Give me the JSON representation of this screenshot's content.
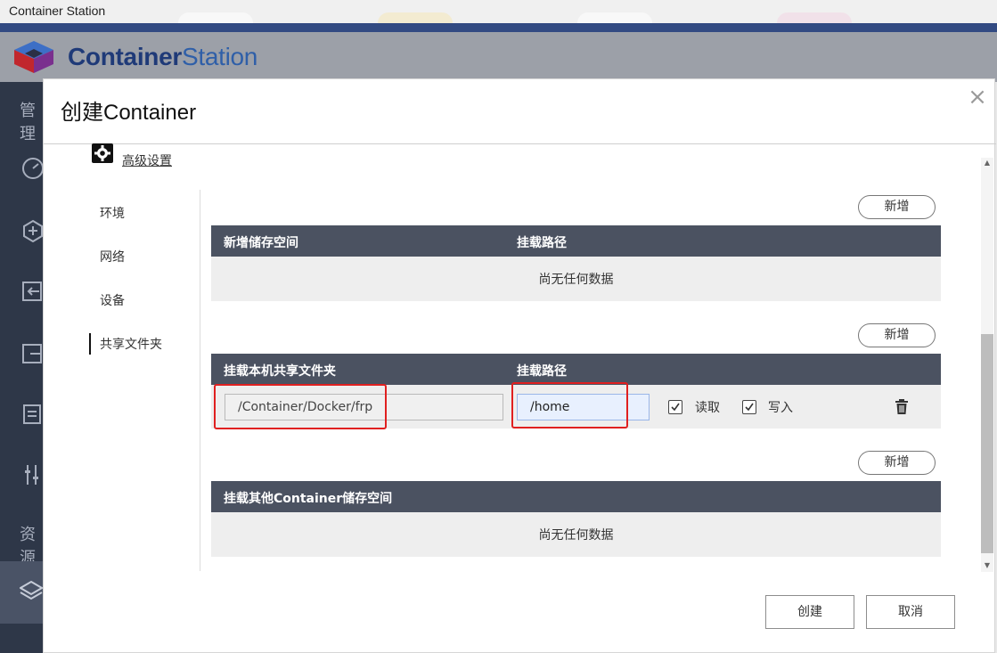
{
  "window": {
    "title": "Container Station"
  },
  "app": {
    "name_bold": "Container",
    "name_light": "Station"
  },
  "sidebar": {
    "group1": "管理",
    "group2": "资源"
  },
  "modal": {
    "title": "创建Container",
    "advanced_link": "高级设置",
    "nav": [
      "环境",
      "网络",
      "设备",
      "共享文件夹"
    ],
    "active_nav": "共享文件夹",
    "add_label": "新增",
    "section1": {
      "col1": "新增储存空间",
      "col2": "挂载路径",
      "empty": "尚无任何数据"
    },
    "section2": {
      "col1": "挂载本机共享文件夹",
      "col2": "挂载路径",
      "row": {
        "host_path": "/Container/Docker/frp",
        "mount_path": "/home",
        "read_label": "读取",
        "read_checked": true,
        "write_label": "写入",
        "write_checked": true
      }
    },
    "section3": {
      "col1": "挂载其他Container储存空间",
      "empty": "尚无任何数据"
    },
    "create_label": "创建",
    "cancel_label": "取消"
  },
  "colors": {
    "accent": "#1f3a78",
    "table_header": "#4b5261",
    "highlight": "#e02020"
  },
  "icons": [
    "logo-icon",
    "dashboard-icon",
    "hexagon-plus-icon",
    "import-icon",
    "export-icon",
    "list-icon",
    "sliders-icon",
    "layers-icon",
    "gear-icon",
    "close-icon",
    "checkbox-icon",
    "trash-icon"
  ]
}
